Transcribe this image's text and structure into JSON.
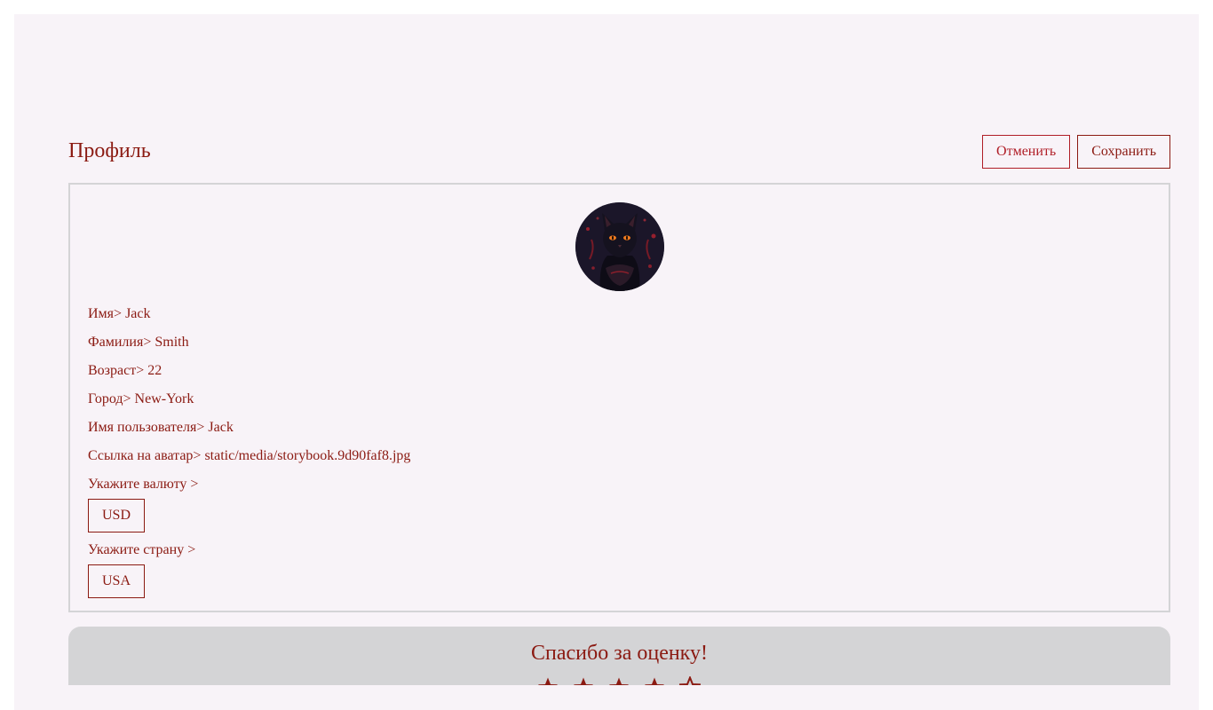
{
  "profile": {
    "title": "Профиль",
    "cancel_label": "Отменить",
    "save_label": "Сохранить"
  },
  "fields": [
    {
      "label": "Имя>",
      "value": "Jack"
    },
    {
      "label": "Фамилия>",
      "value": "Smith"
    },
    {
      "label": "Возраст>",
      "value": "22"
    },
    {
      "label": "Город>",
      "value": "New-York"
    },
    {
      "label": "Имя пользователя>",
      "value": "Jack"
    },
    {
      "label": "Ссылка на аватар>",
      "value": "static/media/storybook.9d90faf8.jpg"
    }
  ],
  "currency": {
    "label": "Укажите валюту >",
    "selected": "USD"
  },
  "country": {
    "label": "Укажите страну >",
    "selected": "USA"
  },
  "rating": {
    "title": "Спасибо за оценку!",
    "selected_stars": 4,
    "max_stars": 5
  },
  "avatar": {
    "icon": "black-cat-avatar"
  },
  "colors": {
    "text_accent": "#8b1a12",
    "button_border": "#b01e27",
    "card_border": "#d4d4d6",
    "app_background": "#f8f3f8",
    "rating_background": "#d4d4d6"
  }
}
